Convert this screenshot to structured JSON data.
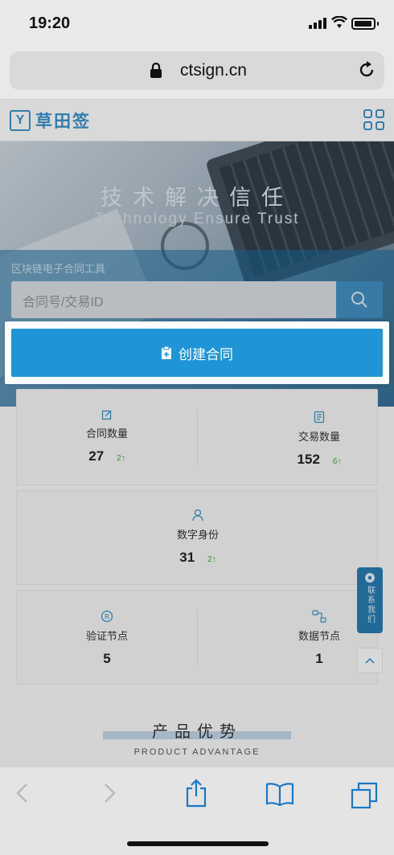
{
  "status_bar": {
    "time": "19:20"
  },
  "browser": {
    "url": "ctsign.cn"
  },
  "site": {
    "brand": "草田签",
    "logo_mark": "Y",
    "hero_title": "技术解决信任",
    "hero_subtitle": "Technology Ensure Trust",
    "chain_tool_label": "区块链电子合同工具",
    "search_placeholder": "合同号/交易ID",
    "create_button": "创建合同"
  },
  "stats": {
    "contracts": {
      "label": "合同数量",
      "value": "27",
      "delta": "2↑"
    },
    "transactions": {
      "label": "交易数量",
      "value": "152",
      "delta": "6↑"
    },
    "identities": {
      "label": "数字身份",
      "value": "31",
      "delta": "2↑"
    },
    "verify_nodes": {
      "label": "验证节点",
      "value": "5"
    },
    "data_nodes": {
      "label": "数据节点",
      "value": "1"
    }
  },
  "advantage": {
    "title": "产品优势",
    "subtitle": "PRODUCT ADVANTAGE"
  },
  "contact_tab": "联系我们",
  "colors": {
    "accent": "#1f95d8",
    "brand": "#3b8fc4",
    "up": "#4a9d3f"
  }
}
